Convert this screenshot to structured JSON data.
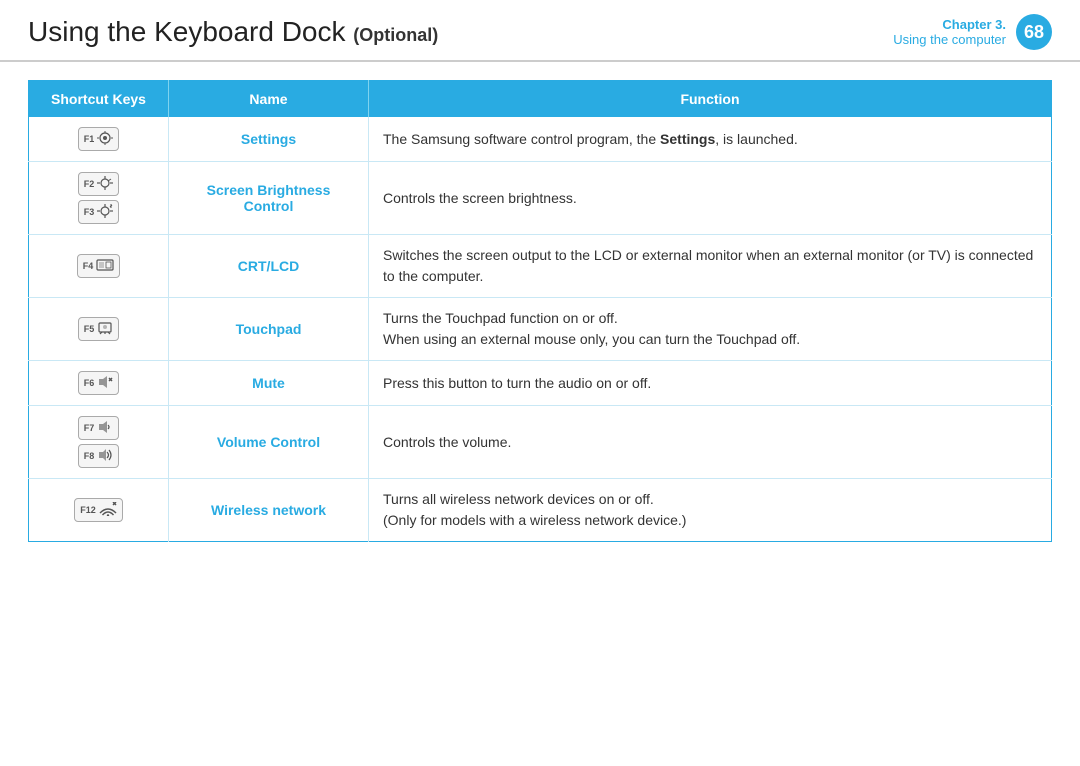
{
  "header": {
    "title_start": "Using the Keyboard Dock",
    "title_optional": "(Optional)",
    "chapter_label": "Chapter 3.",
    "chapter_sub": "Using the computer",
    "page_number": "68"
  },
  "table": {
    "columns": [
      "Shortcut Keys",
      "Name",
      "Function"
    ],
    "rows": [
      {
        "keys": [
          {
            "label": "F1",
            "icon": "⚙"
          }
        ],
        "name": "Settings",
        "function": "The Samsung software control program, the <b>Settings</b>, is launched."
      },
      {
        "keys": [
          {
            "label": "F2",
            "icon": "☀-"
          },
          {
            "label": "F3",
            "icon": "☀+"
          }
        ],
        "name": "Screen Brightness Control",
        "function": "Controls the screen brightness."
      },
      {
        "keys": [
          {
            "label": "F4",
            "icon": "⊡"
          }
        ],
        "name": "CRT/LCD",
        "function": "Switches the screen output to the LCD or external monitor when an external monitor (or TV) is connected to the computer."
      },
      {
        "keys": [
          {
            "label": "F5",
            "icon": "⌨"
          }
        ],
        "name": "Touchpad",
        "function": "Turns the Touchpad function on or off.\nWhen using an external mouse only, you can turn the Touchpad off."
      },
      {
        "keys": [
          {
            "label": "F6",
            "icon": "🔇"
          }
        ],
        "name": "Mute",
        "function": "Press this button to turn the audio on or off."
      },
      {
        "keys": [
          {
            "label": "F7",
            "icon": "🔉"
          },
          {
            "label": "F8",
            "icon": "🔊"
          }
        ],
        "name": "Volume Control",
        "function": "Controls the volume."
      },
      {
        "keys": [
          {
            "label": "F12",
            "icon": "📶"
          }
        ],
        "name": "Wireless network",
        "function": "Turns all wireless network devices on or off.\n(Only for models with a wireless network device.)"
      }
    ]
  }
}
